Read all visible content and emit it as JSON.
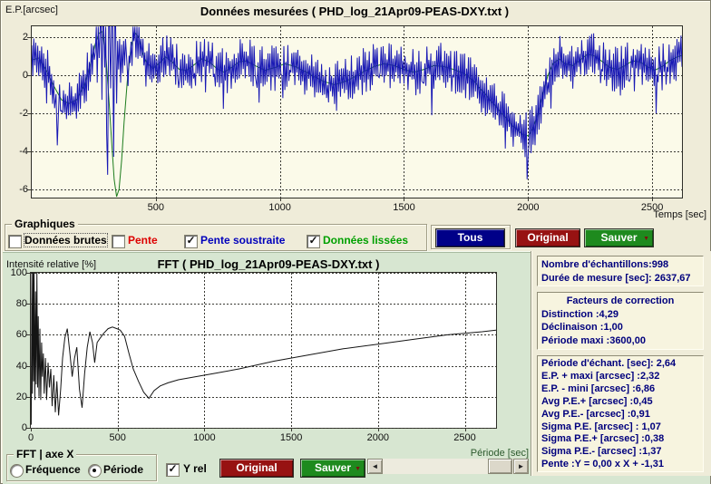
{
  "icons": {
    "check": "✓",
    "dropdown": "▼",
    "scroll_left": "◄",
    "scroll_right": "►"
  },
  "colors": {
    "window_bg": "#efecd9",
    "fft_panel_bg": "#d7e6d1",
    "navy_text": "#00007d",
    "blue_series": "#1818b4",
    "green_series": "#1e7d1e"
  },
  "graphiques": {
    "label": "Graphiques",
    "items": [
      {
        "label": "Données brutes",
        "checked": false,
        "color": "#000000"
      },
      {
        "label": "Pente",
        "checked": false,
        "color": "#dd0000"
      },
      {
        "label": "Pente soustraite",
        "checked": true,
        "color": "#0000bb"
      },
      {
        "label": "Données lissées",
        "checked": true,
        "color": "#00a000"
      }
    ],
    "buttons": [
      {
        "label": "Tous",
        "bg": "#000088"
      },
      {
        "label": "Original",
        "bg": "#971212"
      },
      {
        "label": "Sauver",
        "bg": "#1e8a1e",
        "has_dropdown": true
      }
    ]
  },
  "fft_controls": {
    "group_label": "FFT | axe X",
    "radios": [
      {
        "label": "Fréquence",
        "selected": false
      },
      {
        "label": "Période",
        "selected": true
      }
    ],
    "y_rel": {
      "label": "Y rel",
      "checked": true
    },
    "buttons": [
      {
        "label": "Original",
        "bg": "#971212"
      },
      {
        "label": "Sauver",
        "bg": "#1e8a1e",
        "has_dropdown": true
      }
    ]
  },
  "right_panel": {
    "samples_box": {
      "lines": [
        "Nombre d'échantillons:998",
        "Durée de mesure [sec]: 2637,67"
      ]
    },
    "correction_box": {
      "title": "Facteurs de correction",
      "lines": [
        "Distinction :4,29",
        "Déclinaison :1,00",
        "Période maxi :3600,00"
      ]
    },
    "stats_box": {
      "lines": [
        "Période d'échant. [sec]: 2,64",
        "E.P. + maxi [arcsec] :2,32",
        "E.P. - mini [arcsec] :6,86",
        "Avg P.E.+ [arcsec] :0,45",
        "Avg P.E.- [arcsec] :0,91",
        "Sigma P.E. [arcsec] : 1,07",
        "Sigma P.E.+ [arcsec] :0,38",
        "Sigma P.E.- [arcsec] :1,37",
        "Pente :Y = 0,00 x X + -1,31"
      ]
    }
  },
  "chart_data": [
    {
      "type": "line",
      "title": "Données mesurées ( PHD_log_21Apr09-PEAS-DXY.txt )",
      "xlabel": "Temps [sec]",
      "ylabel": "E.P.[arcsec]",
      "xlim": [
        0,
        2620
      ],
      "ylim": [
        -6.45,
        2.57
      ],
      "x_ticks": [
        500,
        1000,
        1500,
        2000,
        2500
      ],
      "y_ticks": [
        2,
        0,
        -2,
        -4,
        -6
      ],
      "grid": true,
      "plot_bg": "#fbfae9",
      "xlabel_color": "#111111",
      "series": [
        {
          "name": "Données lissées",
          "color": "#1e7d1e",
          "points": [
            [
              0,
              0.8
            ],
            [
              30,
              0.9
            ],
            [
              60,
              0.2
            ],
            [
              90,
              -0.6
            ],
            [
              120,
              -1.3
            ],
            [
              150,
              -1.5
            ],
            [
              180,
              -1.3
            ],
            [
              210,
              -0.6
            ],
            [
              235,
              0.5
            ],
            [
              255,
              1.6
            ],
            [
              270,
              2.2
            ],
            [
              285,
              2.3
            ],
            [
              300,
              0.8
            ],
            [
              312,
              -1.5
            ],
            [
              322,
              -3.5
            ],
            [
              332,
              -5.5
            ],
            [
              342,
              -6.4
            ],
            [
              352,
              -6.0
            ],
            [
              362,
              -4.5
            ],
            [
              372,
              -2.5
            ],
            [
              385,
              -0.3
            ],
            [
              400,
              1.5
            ],
            [
              415,
              2.25
            ],
            [
              430,
              2.0
            ],
            [
              445,
              1.2
            ],
            [
              465,
              0.6
            ],
            [
              490,
              0.35
            ],
            [
              515,
              0.65
            ],
            [
              540,
              0.95
            ],
            [
              565,
              0.7
            ],
            [
              595,
              0.3
            ],
            [
              625,
              0.25
            ],
            [
              655,
              0.55
            ],
            [
              685,
              0.85
            ],
            [
              715,
              0.7
            ],
            [
              745,
              0.35
            ],
            [
              775,
              0.15
            ],
            [
              805,
              0.4
            ],
            [
              835,
              0.7
            ],
            [
              865,
              0.75
            ],
            [
              900,
              0.5
            ],
            [
              940,
              0.25
            ],
            [
              980,
              0.4
            ],
            [
              1020,
              0.6
            ],
            [
              1060,
              0.45
            ],
            [
              1100,
              0.2
            ],
            [
              1140,
              -0.1
            ],
            [
              1180,
              -0.35
            ],
            [
              1220,
              -0.5
            ],
            [
              1260,
              -0.35
            ],
            [
              1300,
              -0.1
            ],
            [
              1340,
              0.2
            ],
            [
              1380,
              0.45
            ],
            [
              1420,
              0.6
            ],
            [
              1460,
              0.5
            ],
            [
              1500,
              0.3
            ],
            [
              1540,
              0.15
            ],
            [
              1580,
              0.3
            ],
            [
              1620,
              0.5
            ],
            [
              1660,
              0.45
            ],
            [
              1700,
              0.3
            ],
            [
              1740,
              0.1
            ],
            [
              1780,
              -0.3
            ],
            [
              1820,
              -0.9
            ],
            [
              1860,
              -1.5
            ],
            [
              1900,
              -2.1
            ],
            [
              1940,
              -2.7
            ],
            [
              1975,
              -3.1
            ],
            [
              2000,
              -3.2
            ],
            [
              2020,
              -2.8
            ],
            [
              2040,
              -2.0
            ],
            [
              2060,
              -1.0
            ],
            [
              2080,
              0.0
            ],
            [
              2100,
              0.6
            ],
            [
              2125,
              0.85
            ],
            [
              2150,
              0.6
            ],
            [
              2180,
              0.5
            ],
            [
              2210,
              0.8
            ],
            [
              2240,
              1.1
            ],
            [
              2270,
              1.0
            ],
            [
              2300,
              0.7
            ],
            [
              2330,
              0.4
            ],
            [
              2360,
              0.3
            ],
            [
              2390,
              0.5
            ],
            [
              2420,
              0.75
            ],
            [
              2450,
              0.7
            ],
            [
              2480,
              0.45
            ],
            [
              2510,
              0.25
            ],
            [
              2540,
              0.45
            ],
            [
              2570,
              0.75
            ],
            [
              2600,
              0.95
            ],
            [
              2637,
              1.1
            ]
          ]
        },
        {
          "name": "Pente soustraite",
          "color": "#1818b4",
          "gen": {
            "seed": 11,
            "dt": 4,
            "tmax": 2637,
            "amp": 1.0,
            "spike_prob": 0.07,
            "spike_extra": 1.2,
            "base": 0
          },
          "overrides": [
            [
              98,
              -1.0
            ],
            [
              103,
              -3.7
            ],
            [
              108,
              -1.8
            ],
            [
              112,
              -0.5
            ],
            [
              256,
              1.2
            ],
            [
              260,
              2.55
            ],
            [
              264,
              -0.4
            ],
            [
              268,
              2.55
            ],
            [
              272,
              0.9
            ],
            [
              276,
              2.55
            ],
            [
              280,
              2.55
            ],
            [
              283,
              -1.3
            ],
            [
              286,
              2.55
            ],
            [
              290,
              2.55
            ],
            [
              294,
              0.4
            ],
            [
              298,
              2.55
            ],
            [
              302,
              -3.1
            ],
            [
              306,
              -5.25
            ],
            [
              310,
              2.55
            ],
            [
              314,
              2.55
            ],
            [
              318,
              -0.7
            ],
            [
              322,
              2.55
            ],
            [
              326,
              2.55
            ],
            [
              330,
              -4.3
            ],
            [
              334,
              2.55
            ],
            [
              338,
              2.55
            ],
            [
              342,
              -1.5
            ],
            [
              346,
              1.8
            ],
            [
              350,
              0.3
            ],
            [
              354,
              1.9
            ],
            [
              358,
              -0.4
            ],
            [
              362,
              1.6
            ],
            [
              366,
              0.1
            ],
            [
              370,
              1.8
            ],
            [
              374,
              0.5
            ],
            [
              378,
              1.9
            ]
          ]
        }
      ]
    },
    {
      "type": "line",
      "title": "FFT ( PHD_log_21Apr09-PEAS-DXY.txt )",
      "xlabel": "Période [sec]",
      "ylabel": "Intensité relative [%]",
      "xlim": [
        0,
        2680
      ],
      "ylim": [
        0,
        100
      ],
      "x_ticks": [
        0,
        500,
        1000,
        1500,
        2000,
        2500
      ],
      "y_ticks": [
        100,
        80,
        60,
        40,
        20,
        0
      ],
      "grid": true,
      "plot_bg": "#ffffff",
      "xlabel_color": "#2d5a2d",
      "series": [
        {
          "name": "FFT",
          "color": "#141414",
          "points": [
            [
              2,
              2
            ],
            [
              6,
              100
            ],
            [
              9,
              22
            ],
            [
              13,
              100
            ],
            [
              16,
              30
            ],
            [
              19,
              100
            ],
            [
              23,
              18
            ],
            [
              27,
              88
            ],
            [
              31,
              28
            ],
            [
              35,
              100
            ],
            [
              39,
              26
            ],
            [
              43,
              72
            ],
            [
              47,
              20
            ],
            [
              52,
              64
            ],
            [
              57,
              18
            ],
            [
              62,
              55
            ],
            [
              67,
              33
            ],
            [
              72,
              48
            ],
            [
              77,
              22
            ],
            [
              84,
              45
            ],
            [
              91,
              18
            ],
            [
              99,
              42
            ],
            [
              107,
              26
            ],
            [
              115,
              38
            ],
            [
              123,
              14
            ],
            [
              132,
              34
            ],
            [
              141,
              10
            ],
            [
              150,
              30
            ],
            [
              160,
              8
            ],
            [
              172,
              25
            ],
            [
              183,
              45
            ],
            [
              196,
              58
            ],
            [
              210,
              64
            ],
            [
              225,
              48
            ],
            [
              238,
              33
            ],
            [
              252,
              45
            ],
            [
              265,
              52
            ],
            [
              280,
              25
            ],
            [
              295,
              13
            ],
            [
              310,
              35
            ],
            [
              325,
              52
            ],
            [
              340,
              62
            ],
            [
              355,
              55
            ],
            [
              368,
              42
            ],
            [
              382,
              55
            ],
            [
              400,
              58
            ],
            [
              420,
              61
            ],
            [
              445,
              64
            ],
            [
              470,
              65
            ],
            [
              495,
              64
            ],
            [
              515,
              63
            ],
            [
              540,
              59
            ],
            [
              565,
              48
            ],
            [
              590,
              38
            ],
            [
              620,
              30
            ],
            [
              650,
              23
            ],
            [
              680,
              19
            ],
            [
              710,
              24
            ],
            [
              745,
              27
            ],
            [
              790,
              29
            ],
            [
              850,
              31
            ],
            [
              950,
              33
            ],
            [
              1050,
              35
            ],
            [
              1200,
              38
            ],
            [
              1400,
              43
            ],
            [
              1600,
              47
            ],
            [
              1800,
              51
            ],
            [
              2000,
              54
            ],
            [
              2200,
              57
            ],
            [
              2400,
              60
            ],
            [
              2600,
              62
            ],
            [
              2680,
              63
            ]
          ]
        }
      ]
    }
  ]
}
